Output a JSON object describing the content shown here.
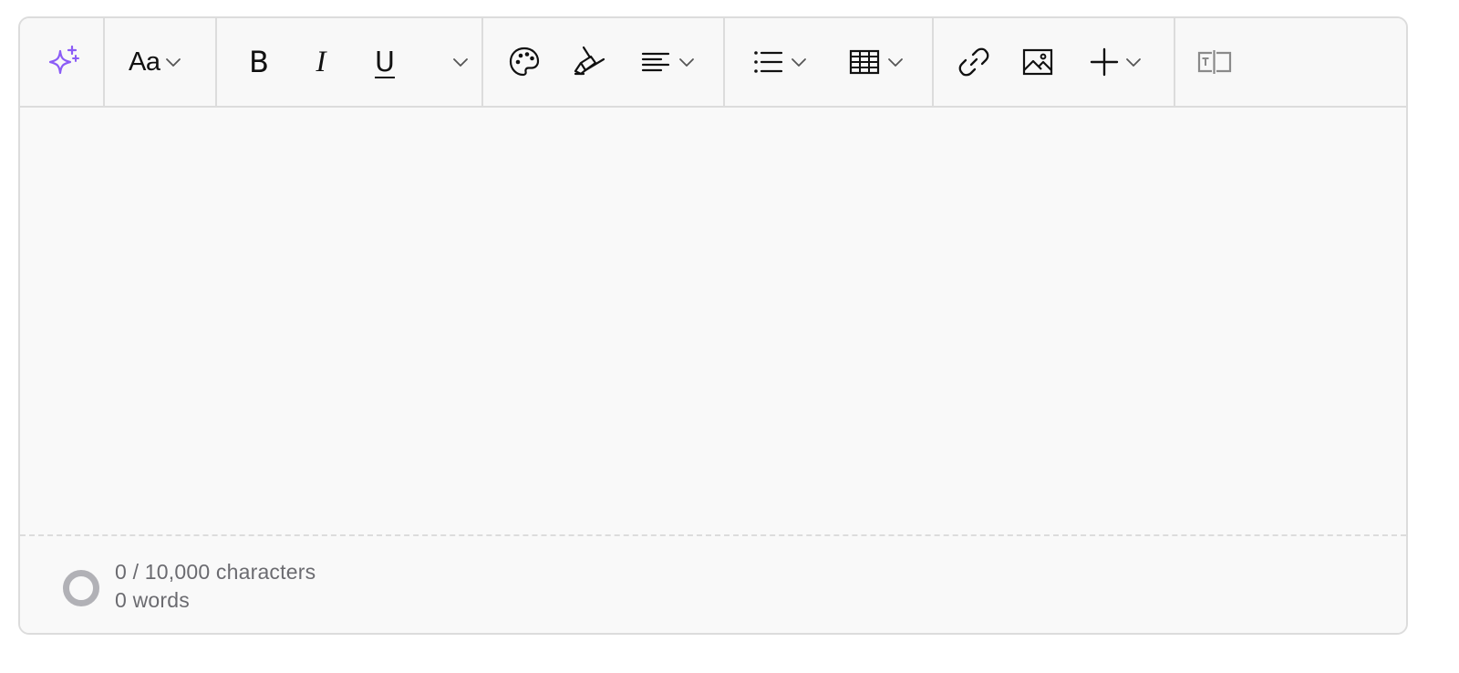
{
  "toolbar": {
    "ai_icon_color": "#8b5cf6",
    "icon_color": "#111111",
    "muted_icon_color": "#8a8a8a",
    "text_style_label": "Aa",
    "bold_label": "B",
    "italic_label": "I",
    "underline_label": "U"
  },
  "footer": {
    "characters": "0 / 10,000 characters",
    "words": "0 words"
  }
}
